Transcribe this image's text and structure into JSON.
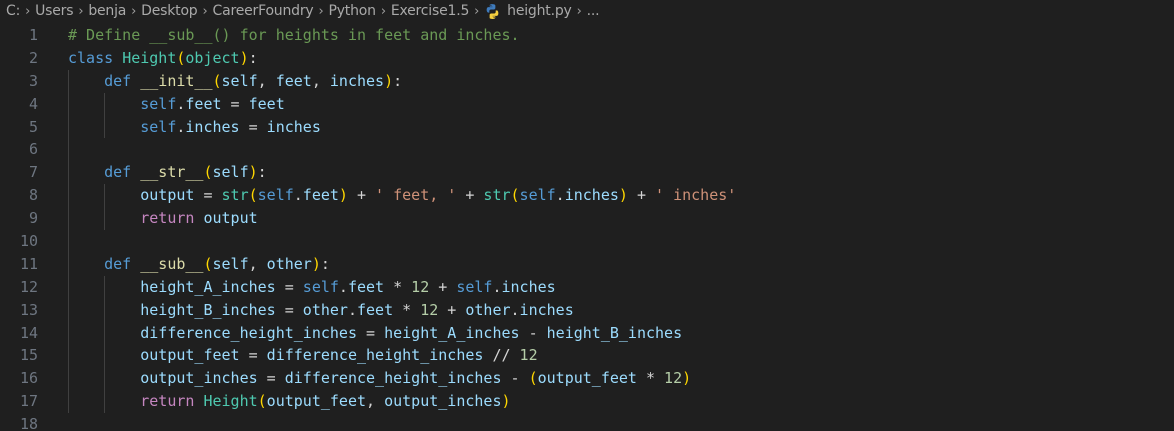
{
  "breadcrumb": {
    "items": [
      "C:",
      "Users",
      "benja",
      "Desktop",
      "CareerFoundry",
      "Python",
      "Exercise1.5"
    ],
    "file": "height.py",
    "file_icon": "python-icon",
    "ellipsis": "..."
  },
  "colors": {
    "background": "#1f1f1f",
    "comment": "#6a9955",
    "keyword": "#569cd6",
    "control": "#c586c0",
    "class": "#4ec9b0",
    "function": "#dcdcaa",
    "variable": "#9cdcfe",
    "string": "#ce9178",
    "number": "#b5cea8"
  },
  "code": {
    "lines": [
      {
        "n": "1",
        "indent": 0,
        "tokens": [
          [
            "comment",
            "# Define __sub__() for heights in feet and inches."
          ]
        ]
      },
      {
        "n": "2",
        "indent": 0,
        "tokens": [
          [
            "kw",
            "class"
          ],
          [
            "plain",
            " "
          ],
          [
            "class",
            "Height"
          ],
          [
            "paren1",
            "("
          ],
          [
            "class",
            "object"
          ],
          [
            "paren1",
            ")"
          ],
          [
            "plain",
            ":"
          ]
        ]
      },
      {
        "n": "3",
        "indent": 1,
        "tokens": [
          [
            "kw",
            "def"
          ],
          [
            "plain",
            " "
          ],
          [
            "func",
            "__init__"
          ],
          [
            "paren1",
            "("
          ],
          [
            "var",
            "self"
          ],
          [
            "plain",
            ", "
          ],
          [
            "var",
            "feet"
          ],
          [
            "plain",
            ", "
          ],
          [
            "var",
            "inches"
          ],
          [
            "paren1",
            ")"
          ],
          [
            "plain",
            ":"
          ]
        ]
      },
      {
        "n": "4",
        "indent": 2,
        "tokens": [
          [
            "kw",
            "self"
          ],
          [
            "plain",
            "."
          ],
          [
            "var",
            "feet"
          ],
          [
            "op",
            " = "
          ],
          [
            "var",
            "feet"
          ]
        ]
      },
      {
        "n": "5",
        "indent": 2,
        "tokens": [
          [
            "kw",
            "self"
          ],
          [
            "plain",
            "."
          ],
          [
            "var",
            "inches"
          ],
          [
            "op",
            " = "
          ],
          [
            "var",
            "inches"
          ]
        ]
      },
      {
        "n": "6",
        "indent": 1,
        "tokens": []
      },
      {
        "n": "7",
        "indent": 1,
        "tokens": [
          [
            "kw",
            "def"
          ],
          [
            "plain",
            " "
          ],
          [
            "func",
            "__str__"
          ],
          [
            "paren1",
            "("
          ],
          [
            "var",
            "self"
          ],
          [
            "paren1",
            ")"
          ],
          [
            "plain",
            ":"
          ]
        ]
      },
      {
        "n": "8",
        "indent": 2,
        "tokens": [
          [
            "var",
            "output"
          ],
          [
            "op",
            " = "
          ],
          [
            "class",
            "str"
          ],
          [
            "paren1",
            "("
          ],
          [
            "kw",
            "self"
          ],
          [
            "plain",
            "."
          ],
          [
            "var",
            "feet"
          ],
          [
            "paren1",
            ")"
          ],
          [
            "op",
            " + "
          ],
          [
            "str",
            "' feet, '"
          ],
          [
            "op",
            " + "
          ],
          [
            "class",
            "str"
          ],
          [
            "paren1",
            "("
          ],
          [
            "kw",
            "self"
          ],
          [
            "plain",
            "."
          ],
          [
            "var",
            "inches"
          ],
          [
            "paren1",
            ")"
          ],
          [
            "op",
            " + "
          ],
          [
            "str",
            "' inches'"
          ]
        ]
      },
      {
        "n": "9",
        "indent": 2,
        "tokens": [
          [
            "ctrl",
            "return"
          ],
          [
            "plain",
            " "
          ],
          [
            "var",
            "output"
          ]
        ]
      },
      {
        "n": "10",
        "indent": 1,
        "tokens": []
      },
      {
        "n": "11",
        "indent": 1,
        "tokens": [
          [
            "kw",
            "def"
          ],
          [
            "plain",
            " "
          ],
          [
            "func",
            "__sub__"
          ],
          [
            "paren1",
            "("
          ],
          [
            "var",
            "self"
          ],
          [
            "plain",
            ", "
          ],
          [
            "var",
            "other"
          ],
          [
            "paren1",
            ")"
          ],
          [
            "plain",
            ":"
          ]
        ]
      },
      {
        "n": "12",
        "indent": 2,
        "tokens": [
          [
            "var",
            "height_A_inches"
          ],
          [
            "op",
            " = "
          ],
          [
            "kw",
            "self"
          ],
          [
            "plain",
            "."
          ],
          [
            "var",
            "feet"
          ],
          [
            "op",
            " * "
          ],
          [
            "num",
            "12"
          ],
          [
            "op",
            " + "
          ],
          [
            "kw",
            "self"
          ],
          [
            "plain",
            "."
          ],
          [
            "var",
            "inches"
          ]
        ]
      },
      {
        "n": "13",
        "indent": 2,
        "tokens": [
          [
            "var",
            "height_B_inches"
          ],
          [
            "op",
            " = "
          ],
          [
            "var",
            "other"
          ],
          [
            "plain",
            "."
          ],
          [
            "var",
            "feet"
          ],
          [
            "op",
            " * "
          ],
          [
            "num",
            "12"
          ],
          [
            "op",
            " + "
          ],
          [
            "var",
            "other"
          ],
          [
            "plain",
            "."
          ],
          [
            "var",
            "inches"
          ]
        ]
      },
      {
        "n": "14",
        "indent": 2,
        "tokens": [
          [
            "var",
            "difference_height_inches"
          ],
          [
            "op",
            " = "
          ],
          [
            "var",
            "height_A_inches"
          ],
          [
            "op",
            " - "
          ],
          [
            "var",
            "height_B_inches"
          ]
        ]
      },
      {
        "n": "15",
        "indent": 2,
        "tokens": [
          [
            "var",
            "output_feet"
          ],
          [
            "op",
            " = "
          ],
          [
            "var",
            "difference_height_inches"
          ],
          [
            "op",
            " // "
          ],
          [
            "num",
            "12"
          ]
        ]
      },
      {
        "n": "16",
        "indent": 2,
        "tokens": [
          [
            "var",
            "output_inches"
          ],
          [
            "op",
            " = "
          ],
          [
            "var",
            "difference_height_inches"
          ],
          [
            "op",
            " - "
          ],
          [
            "paren1",
            "("
          ],
          [
            "var",
            "output_feet"
          ],
          [
            "op",
            " * "
          ],
          [
            "num",
            "12"
          ],
          [
            "paren1",
            ")"
          ]
        ]
      },
      {
        "n": "17",
        "indent": 2,
        "tokens": [
          [
            "ctrl",
            "return"
          ],
          [
            "plain",
            " "
          ],
          [
            "class",
            "Height"
          ],
          [
            "paren1",
            "("
          ],
          [
            "var",
            "output_feet"
          ],
          [
            "plain",
            ", "
          ],
          [
            "var",
            "output_inches"
          ],
          [
            "paren1",
            ")"
          ]
        ]
      },
      {
        "n": "18",
        "indent": 0,
        "tokens": []
      }
    ]
  }
}
